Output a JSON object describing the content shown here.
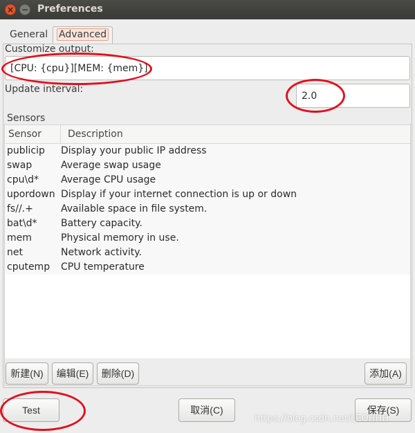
{
  "window": {
    "title": "Preferences"
  },
  "tabs": [
    {
      "label": "General"
    },
    {
      "label": "Advanced"
    }
  ],
  "advanced": {
    "customize_label": "Customize output:",
    "customize_value": "[CPU: {cpu}][MEM: {mem}]",
    "interval_label": "Update interval:",
    "interval_value": "2.0",
    "sensors_label": "Sensors"
  },
  "sensors_table": {
    "headers": [
      "Sensor",
      "Description"
    ],
    "rows": [
      {
        "sensor": "publicip",
        "description": "Display your public IP address"
      },
      {
        "sensor": "swap",
        "description": "Average swap usage"
      },
      {
        "sensor": "cpu\\d*",
        "description": "Average CPU usage"
      },
      {
        "sensor": "upordown",
        "description": "Display if your internet connection is up or down"
      },
      {
        "sensor": "fs//.+",
        "description": "Available space in file system."
      },
      {
        "sensor": "bat\\d*",
        "description": "Battery capacity."
      },
      {
        "sensor": "mem",
        "description": "Physical memory in use."
      },
      {
        "sensor": "net",
        "description": "Network activity."
      },
      {
        "sensor": "cputemp",
        "description": "CPU temperature"
      }
    ]
  },
  "sensor_buttons": {
    "new": "新建(N)",
    "edit": "编辑(E)",
    "delete": "删除(D)",
    "add": "添加(A)"
  },
  "dialog_buttons": {
    "test": "Test",
    "cancel": "取消(C)",
    "save": "保存(S)"
  },
  "watermark": "https://blog.csdn.net/LEOHHH"
}
